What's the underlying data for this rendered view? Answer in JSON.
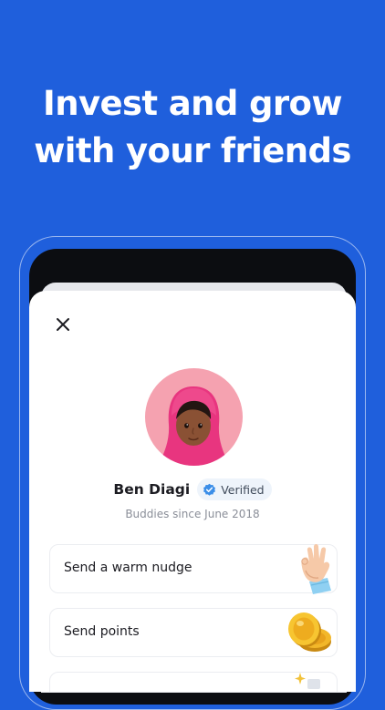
{
  "headline": {
    "line1": "Invest and grow",
    "line2": "with your friends"
  },
  "profile": {
    "name": "Ben Diagi",
    "verified_label": "Verified",
    "since_text": "Buddies since June 2018"
  },
  "actions": [
    {
      "label": "Send a warm nudge",
      "icon": "waving-hand-icon"
    },
    {
      "label": "Send points",
      "icon": "coins-icon"
    },
    {
      "label": "",
      "icon": "sparkle-icon"
    }
  ],
  "colors": {
    "background": "#1f5fdc",
    "verified_accent": "#3b8ee8",
    "avatar_bg": "#f5a2b0"
  }
}
